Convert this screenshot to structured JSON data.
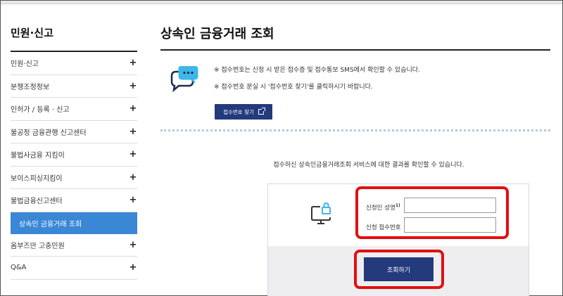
{
  "sidebar": {
    "title": "민원·신고",
    "items": [
      {
        "label": "민원·신고",
        "icon": "plus"
      },
      {
        "label": "분쟁조정정보",
        "icon": "plus"
      },
      {
        "label": "인허가 / 등록 · 신고",
        "icon": "plus"
      },
      {
        "label": "불공정 금융관행 신고센터",
        "icon": "plus"
      },
      {
        "label": "불법사금융 지킴이",
        "icon": "plus"
      },
      {
        "label": "보이스피싱지킴이",
        "icon": "plus"
      },
      {
        "label": "불법금융신고센터",
        "icon": "plus"
      },
      {
        "label": "상속인 금융거래 조회",
        "active": true
      },
      {
        "label": "옴부즈만 고충민원",
        "icon": "plus"
      },
      {
        "label": "Q&A",
        "icon": "plus"
      }
    ],
    "plus_symbol": "+"
  },
  "main": {
    "title": "상속인 금융거래 조회",
    "notice": {
      "line1": "※ 접수번호는 신청 시 받은 접수증 및 접수통보 SMS에서 확인할 수 있습니다.",
      "line2": "※ 접수번호 분실 시 '접수번호 찾기'를 클릭하시기 바랍니다.",
      "find_button": "접수번호 찾기"
    },
    "result_text": "접수하신 상속인금융거래조회 서비스에 대한 결과를 확인할 수 있습니다.",
    "form": {
      "name_label": "신청인 성명",
      "name_sup": "1)",
      "name_value": "",
      "receipt_label": "신청 접수번호",
      "receipt_value": "",
      "submit_label": "조회하기"
    }
  },
  "colors": {
    "accent_navy": "#233a7c",
    "active_blue": "#3a87d6",
    "highlight_red": "#e01010"
  },
  "icons": [
    "plus-icon",
    "chat-bubble-icon",
    "external-link-icon",
    "monitor-lock-icon"
  ]
}
